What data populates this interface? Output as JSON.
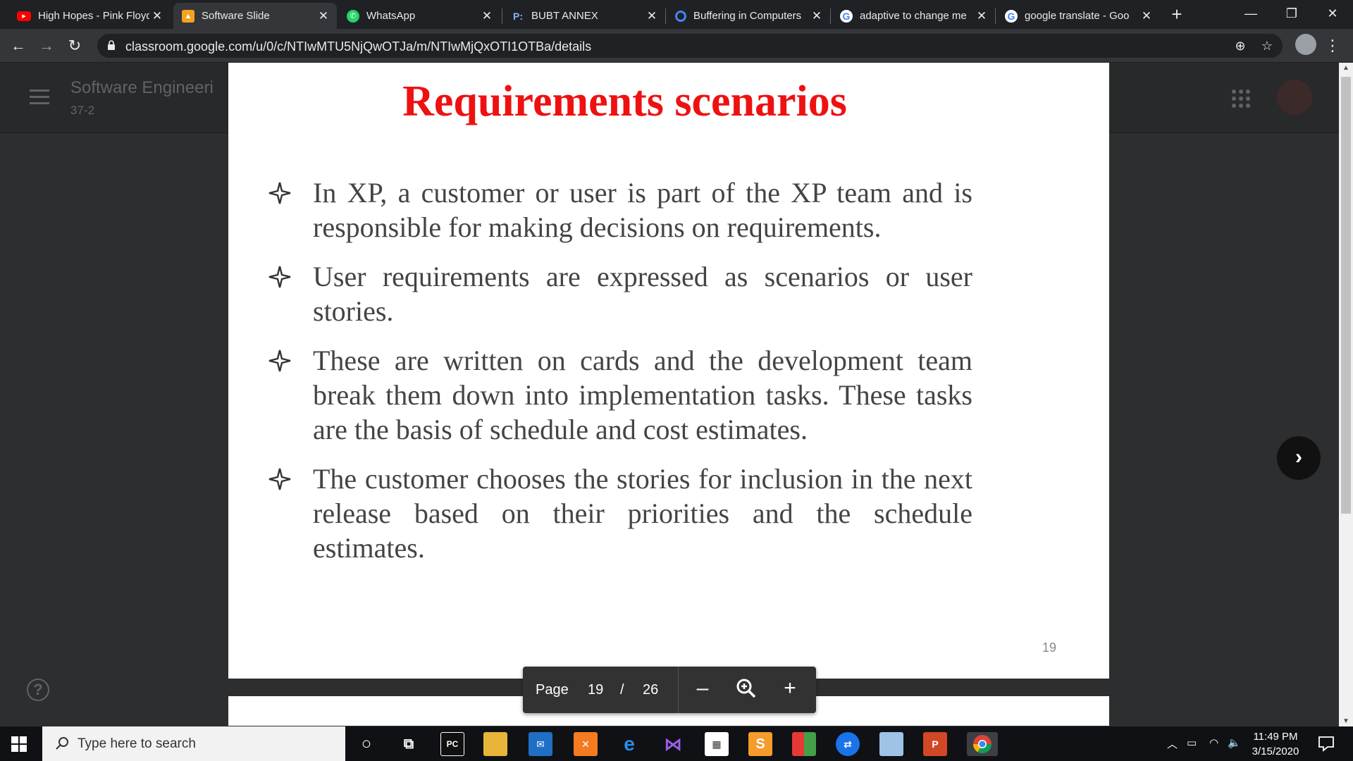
{
  "browser": {
    "tabs": [
      {
        "title": "High Hopes - Pink Floyd",
        "icon": "youtube-icon",
        "color": "#ff0000"
      },
      {
        "title": "Software Slide",
        "icon": "classroom-slides-icon",
        "color": "#f4a321"
      },
      {
        "title": "WhatsApp",
        "icon": "whatsapp-icon",
        "color": "#25d366"
      },
      {
        "title": "BUBT ANNEX",
        "icon": "bubt-icon",
        "color": "#8ab4f8"
      },
      {
        "title": "Buffering in Computers",
        "icon": "quora-icon",
        "color": "#4285f4"
      },
      {
        "title": "adaptive to change me",
        "icon": "google-icon",
        "color": "#ffffff"
      },
      {
        "title": "google translate - Goo",
        "icon": "google-icon",
        "color": "#ffffff"
      }
    ],
    "new_tab": "+",
    "url": "classroom.google.com/u/0/c/NTIwMTU5NjQwOTJa/m/NTIwMjQxOTI1OTBa/details"
  },
  "classroom": {
    "class_title": "Software Engineeri",
    "class_section": "37-2"
  },
  "slide": {
    "title": "Requirements scenarios",
    "bullets": [
      "In XP, a customer or user is part of the XP team and is responsible for making decisions on requirements.",
      "User requirements are expressed as scenarios or user stories.",
      "These are written on cards and the development team break them down into implementation tasks. These tasks are the basis of schedule and cost estimates.",
      "The customer chooses the stories for inclusion in the next release based on their priorities and the schedule estimates."
    ],
    "slide_number": "19",
    "title_color": "#ee1111"
  },
  "viewer": {
    "page_label": "Page",
    "current_page": "19",
    "separator": "/",
    "total_pages": "26"
  },
  "taskbar": {
    "search_placeholder": "Type here to search",
    "time": "11:49 PM",
    "date": "3/15/2020"
  }
}
